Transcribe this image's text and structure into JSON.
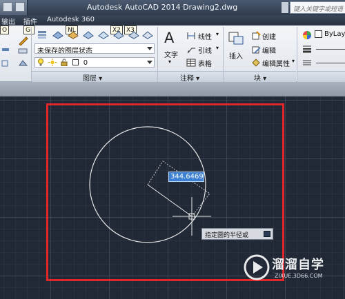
{
  "titlebar": {
    "title": "Autodesk AutoCAD 2014    Drawing2.dwg",
    "search_placeholder": "键入关键字或短语"
  },
  "tabs": [
    {
      "label": "输出"
    },
    {
      "label": "插件"
    },
    {
      "label": "Autodesk 360"
    }
  ],
  "keytips": [
    "O",
    "GI",
    "NL",
    "X2",
    "X3"
  ],
  "ribbon": {
    "layers": {
      "layer_state_value": "未保存的图层状态",
      "layer_value": "0",
      "panel_title": "图层 ▾"
    },
    "annotation": {
      "text_label": "文字",
      "linear_label": "线性",
      "leader_label": "引线",
      "table_label": "表格",
      "panel_title": "注释 ▾"
    },
    "block": {
      "insert_label": "插入",
      "create_label": "创建",
      "edit_label": "编辑",
      "edit_attr_label": "编辑属性",
      "panel_title": "块 ▾"
    },
    "properties": {
      "color_value": "ByLayer"
    }
  },
  "canvas": {
    "dynamic_input_value": "344.6469",
    "tooltip_text": "指定圆的半径或"
  },
  "watermark": {
    "brand": "溜溜自学",
    "url": "ZIXUE.3D66.COM"
  },
  "colors": {
    "highlight_box": "#e0282a",
    "canvas_bg": "#212836",
    "dynamic_input_bg": "#3d7fd0"
  }
}
